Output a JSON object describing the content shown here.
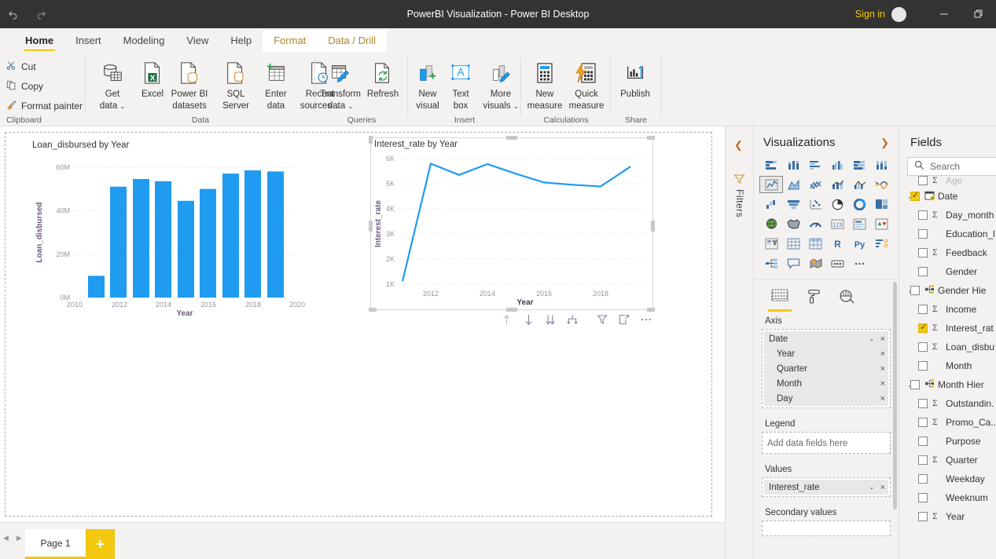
{
  "titlebar": {
    "undo_icon": "undo-arrow-icon",
    "redo_icon": "redo-arrow-icon",
    "title": "PowerBI Visualization - Power BI Desktop",
    "signin_label": "Sign in",
    "minimize_label": "—",
    "restore_label": "❐"
  },
  "ribbon_tabs": [
    {
      "label": "Home",
      "state": "active"
    },
    {
      "label": "Insert",
      "state": "normal"
    },
    {
      "label": "Modeling",
      "state": "normal"
    },
    {
      "label": "View",
      "state": "normal"
    },
    {
      "label": "Help",
      "state": "normal"
    },
    {
      "label": "Format",
      "state": "contextual"
    },
    {
      "label": "Data / Drill",
      "state": "contextual"
    }
  ],
  "ribbon": {
    "groups": [
      {
        "label": "Clipboard"
      },
      {
        "label": "Data"
      },
      {
        "label": "Queries"
      },
      {
        "label": "Insert"
      },
      {
        "label": "Calculations"
      },
      {
        "label": "Share"
      }
    ],
    "clipboard": [
      {
        "label": "Cut",
        "icon": "scissors-icon"
      },
      {
        "label": "Copy",
        "icon": "copy-icon"
      },
      {
        "label": "Format painter",
        "icon": "paintbrush-icon"
      }
    ],
    "buttons": [
      {
        "line1": "Get",
        "line2": "data",
        "caret": true,
        "icon": "database-table-icon"
      },
      {
        "line1": "Excel",
        "line2": "",
        "caret": false,
        "icon": "excel-file-icon"
      },
      {
        "line1": "Power BI",
        "line2": "datasets",
        "caret": false,
        "icon": "powerbi-dataset-icon"
      },
      {
        "line1": "SQL",
        "line2": "Server",
        "caret": false,
        "icon": "sql-server-icon"
      },
      {
        "line1": "Enter",
        "line2": "data",
        "caret": false,
        "icon": "enter-data-grid-icon"
      },
      {
        "line1": "Recent",
        "line2": "sources",
        "caret": true,
        "icon": "recent-sources-clock-icon"
      },
      {
        "line1": "Transform",
        "line2": "data",
        "caret": true,
        "icon": "transform-data-pencil-icon"
      },
      {
        "line1": "Refresh",
        "line2": "",
        "caret": false,
        "icon": "refresh-icon"
      },
      {
        "line1": "New",
        "line2": "visual",
        "caret": false,
        "icon": "new-visual-icon"
      },
      {
        "line1": "Text",
        "line2": "box",
        "caret": false,
        "icon": "text-box-icon"
      },
      {
        "line1": "More",
        "line2": "visuals",
        "caret": true,
        "icon": "more-visuals-icon"
      },
      {
        "line1": "New",
        "line2": "measure",
        "caret": false,
        "icon": "new-measure-calculator-icon"
      },
      {
        "line1": "Quick",
        "line2": "measure",
        "caret": false,
        "icon": "quick-measure-bolt-icon"
      },
      {
        "line1": "Publish",
        "line2": "",
        "caret": false,
        "icon": "publish-upload-icon"
      }
    ]
  },
  "chart_data": [
    {
      "type": "bar",
      "title": "Loan_disbursed by Year",
      "xlabel": "Year",
      "ylabel": "Loan_disbursed",
      "categories": [
        2011,
        2012,
        2013,
        2014,
        2015,
        2016,
        2017,
        2018,
        2019
      ],
      "values": [
        10000000,
        51000000,
        54500000,
        53500000,
        44500000,
        50000000,
        57000000,
        58500000,
        58000000
      ],
      "ylim": [
        0,
        62000000
      ],
      "xlim": [
        2010,
        2020
      ],
      "ytick_labels": [
        "0M",
        "20M",
        "40M",
        "60M"
      ],
      "ytick_values": [
        0,
        20000000,
        40000000,
        60000000
      ],
      "xtick_labels": [
        "2010",
        "2012",
        "2014",
        "2016",
        "2018",
        "2020"
      ],
      "xtick_values": [
        2010,
        2012,
        2014,
        2016,
        2018,
        2020
      ],
      "grid": true,
      "series_color": "#1f9bf0",
      "legend": "none"
    },
    {
      "type": "line",
      "title": "Interest_rate by Year",
      "xlabel": "Year",
      "ylabel": "Interest_rate",
      "x": [
        2011,
        2012,
        2013,
        2014,
        2015,
        2016,
        2017,
        2018,
        2019
      ],
      "values": [
        1480,
        5800,
        5350,
        5780,
        5400,
        5050,
        4960,
        4890,
        5680
      ],
      "ylim": [
        800,
        6200
      ],
      "xlim": [
        2011,
        2019
      ],
      "ytick_labels": [
        "1K",
        "2K",
        "3K",
        "4K",
        "5K",
        "6K"
      ],
      "ytick_values": [
        1000,
        2000,
        3000,
        4000,
        5000,
        6000
      ],
      "xtick_labels": [
        "2012",
        "2014",
        "2016",
        "2018"
      ],
      "xtick_values": [
        2012,
        2014,
        2016,
        2018
      ],
      "grid": true,
      "series_color": "#1f9bf0",
      "legend": "none",
      "selected": true
    }
  ],
  "visual_toolbar": [
    {
      "icon": "drill-up-arrow-icon"
    },
    {
      "icon": "drill-down-arrow-icon"
    },
    {
      "icon": "expand-all-down-icon"
    },
    {
      "icon": "drill-mode-icon"
    },
    {
      "icon": "filter-funnel-icon"
    },
    {
      "icon": "focus-mode-icon"
    },
    {
      "icon": "more-options-icon"
    }
  ],
  "filters_rail": {
    "chevron_icon": "chevron-left-icon",
    "filter_icon": "filter-funnel-icon",
    "label": "Filters"
  },
  "visualizations": {
    "title": "Visualizations",
    "expand_icon": "chevron-right-icon",
    "gallery": [
      "stacked-bar-chart-icon",
      "stacked-column-chart-icon",
      "clustered-bar-chart-icon",
      "clustered-column-chart-icon",
      "100-stacked-bar-chart-icon",
      "100-stacked-column-chart-icon",
      "line-chart-icon",
      "area-chart-icon",
      "stacked-area-chart-icon",
      "line-stacked-column-chart-icon",
      "line-clustered-column-chart-icon",
      "ribbon-chart-icon",
      "waterfall-chart-icon",
      "funnel-chart-icon",
      "scatter-chart-icon",
      "pie-chart-icon",
      "donut-chart-icon",
      "treemap-icon",
      "map-icon",
      "filled-map-icon",
      "gauge-icon",
      "card-icon",
      "multi-row-card-icon",
      "kpi-icon",
      "slicer-icon",
      "table-icon",
      "matrix-icon",
      "r-script-visual-icon",
      "python-visual-icon",
      "key-influencers-icon",
      "decomposition-tree-icon",
      "qna-icon",
      "arcgis-map-icon",
      "paginated-report-icon",
      "more-visuals-ellipsis-icon"
    ],
    "selected_gallery_index": 6,
    "tabs": [
      {
        "icon": "fields-pane-icon",
        "active": true
      },
      {
        "icon": "format-paint-roller-icon",
        "active": false
      },
      {
        "icon": "analytics-magnifier-icon",
        "active": false
      }
    ],
    "wells": [
      {
        "label": "Axis",
        "items": [
          {
            "name": "Date",
            "caret": true,
            "remove": "×",
            "child": false
          },
          {
            "name": "Year",
            "caret": false,
            "remove": "×",
            "child": true
          },
          {
            "name": "Quarter",
            "caret": false,
            "remove": "×",
            "child": true
          },
          {
            "name": "Month",
            "caret": false,
            "remove": "×",
            "child": true
          },
          {
            "name": "Day",
            "caret": false,
            "remove": "×",
            "child": true
          }
        ]
      },
      {
        "label": "Legend",
        "placeholder": "Add data fields here",
        "items": []
      },
      {
        "label": "Values",
        "items": [
          {
            "name": "Interest_rate",
            "caret": true,
            "remove": "×",
            "child": false
          }
        ]
      },
      {
        "label": "Secondary values",
        "items": []
      }
    ]
  },
  "fields": {
    "title": "Fields",
    "search_icon": "search-magnifier-icon",
    "search_placeholder": "Search",
    "search_value": "",
    "items": [
      {
        "label": "Age",
        "checked": false,
        "sigma": true,
        "chevron": false,
        "icon": "",
        "clipped": true
      },
      {
        "label": "Date",
        "checked": true,
        "sigma": false,
        "chevron": true,
        "icon": "calendar-icon"
      },
      {
        "label": "Day_month",
        "checked": false,
        "sigma": true,
        "chevron": false,
        "icon": "",
        "indent": true
      },
      {
        "label": "Education_l",
        "checked": false,
        "sigma": false,
        "chevron": false,
        "icon": "",
        "indent": true
      },
      {
        "label": "Feedback",
        "checked": false,
        "sigma": true,
        "chevron": false,
        "icon": "",
        "indent": true
      },
      {
        "label": "Gender",
        "checked": false,
        "sigma": false,
        "chevron": false,
        "icon": "",
        "indent": true
      },
      {
        "label": "Gender Hie",
        "checked": false,
        "sigma": false,
        "chevron": true,
        "icon": "hierarchy-icon"
      },
      {
        "label": "Income",
        "checked": false,
        "sigma": true,
        "chevron": false,
        "icon": "",
        "indent": true
      },
      {
        "label": "Interest_rat",
        "checked": true,
        "sigma": true,
        "chevron": false,
        "icon": "",
        "indent": true
      },
      {
        "label": "Loan_disbu",
        "checked": false,
        "sigma": true,
        "chevron": false,
        "icon": "",
        "indent": true
      },
      {
        "label": "Month",
        "checked": false,
        "sigma": false,
        "chevron": false,
        "icon": "",
        "indent": true
      },
      {
        "label": "Month Hier",
        "checked": false,
        "sigma": false,
        "chevron": true,
        "icon": "hierarchy-icon"
      },
      {
        "label": "Outstandin.",
        "checked": false,
        "sigma": true,
        "chevron": false,
        "icon": "",
        "indent": true
      },
      {
        "label": "Promo_Ca..",
        "checked": false,
        "sigma": true,
        "chevron": false,
        "icon": "",
        "indent": true
      },
      {
        "label": "Purpose",
        "checked": false,
        "sigma": false,
        "chevron": false,
        "icon": "",
        "indent": true
      },
      {
        "label": "Quarter",
        "checked": false,
        "sigma": true,
        "chevron": false,
        "icon": "",
        "indent": true
      },
      {
        "label": "Weekday",
        "checked": false,
        "sigma": false,
        "chevron": false,
        "icon": "",
        "indent": true
      },
      {
        "label": "Weeknum",
        "checked": false,
        "sigma": false,
        "chevron": false,
        "icon": "",
        "indent": true
      },
      {
        "label": "Year",
        "checked": false,
        "sigma": true,
        "chevron": false,
        "icon": "",
        "indent": true
      }
    ]
  },
  "pagebar": {
    "prev_icon": "page-prev-icon",
    "next_icon": "page-next-icon",
    "tabs": [
      {
        "label": "Page 1",
        "active": true
      }
    ],
    "add_label": "+"
  },
  "colors": {
    "accent": "#f2c811",
    "series": "#1f9bf0",
    "titlebar": "#333333",
    "pane_bg": "#f3f2f1"
  }
}
